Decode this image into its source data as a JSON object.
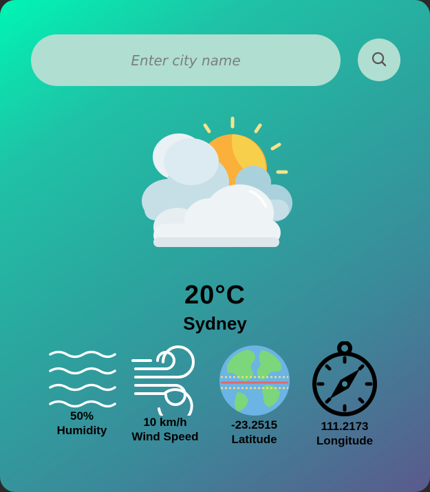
{
  "search": {
    "placeholder": "Enter city name",
    "button_icon": "search-icon"
  },
  "weather": {
    "icon": "partly-cloudy-icon",
    "temperature": "20°C",
    "city": "Sydney"
  },
  "stats": {
    "humidity": {
      "value": "50%",
      "label": "Humidity",
      "icon": "waves-icon"
    },
    "wind": {
      "value": "10 km/h",
      "label": "Wind Speed",
      "icon": "wind-icon"
    },
    "latitude": {
      "value": "-23.2515",
      "label": "Latitude",
      "icon": "globe-icon"
    },
    "longitude": {
      "value": "111.2173",
      "label": "Longitude",
      "icon": "compass-icon"
    }
  },
  "colors": {
    "gradient_start": "#00f5b4",
    "gradient_end": "#5a5a8c",
    "input_bg": "#b0ded0",
    "sun": "#fbb03b",
    "cloud": "#eef3f6"
  }
}
